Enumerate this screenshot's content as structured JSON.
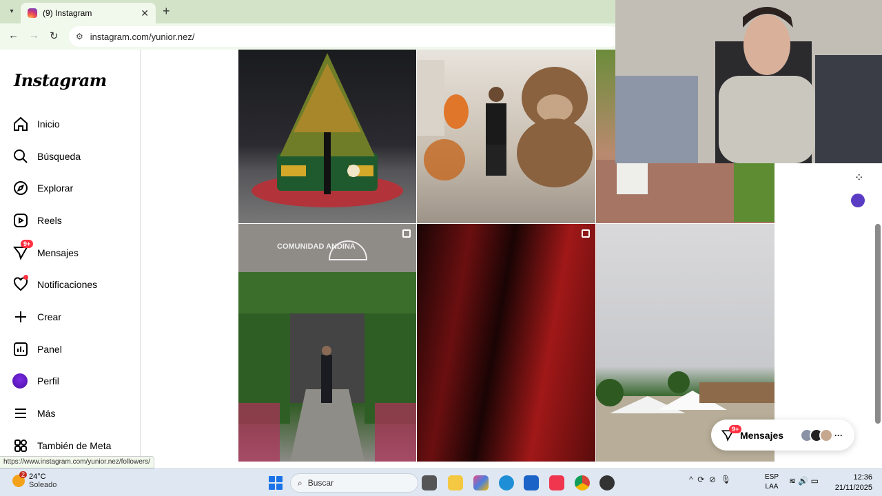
{
  "browser": {
    "tab_title": "(9) Instagram",
    "tab_close": "✕",
    "new_tab": "+",
    "url": "instagram.com/yunior.nez/",
    "status_url": "https://www.instagram.com/yunior.nez/followers/"
  },
  "sidebar": {
    "logo": "Instagram",
    "items": [
      {
        "label": "Inicio",
        "icon": "home-icon"
      },
      {
        "label": "Búsqueda",
        "icon": "search-icon"
      },
      {
        "label": "Explorar",
        "icon": "compass-icon"
      },
      {
        "label": "Reels",
        "icon": "reels-icon"
      },
      {
        "label": "Mensajes",
        "icon": "messenger-icon",
        "badge": "9+"
      },
      {
        "label": "Notificaciones",
        "icon": "heart-icon"
      },
      {
        "label": "Crear",
        "icon": "plus-icon"
      },
      {
        "label": "Panel",
        "icon": "chart-icon"
      },
      {
        "label": "Perfil",
        "icon": "avatar"
      },
      {
        "label": "Más",
        "icon": "menu-icon"
      },
      {
        "label": "También de Meta",
        "icon": "meta-apps-icon"
      }
    ]
  },
  "grid": {
    "photos": [
      {
        "text_sign": "COMUNIDAD ANDINA"
      }
    ]
  },
  "dm_float": {
    "label": "Mensajes",
    "badge": "9+",
    "more": "···"
  },
  "taskbar": {
    "weather_badge": "2",
    "temp": "24°C",
    "condition": "Soleado",
    "search_placeholder": "Buscar",
    "lang_1": "ESP",
    "lang_2": "LAA",
    "time": "12:36",
    "date": "21/11/2025"
  },
  "colors": {
    "accent_red": "#ff3040",
    "chrome_bg": "#d3e3c8",
    "toolbar_bg": "#f1f8ec"
  }
}
